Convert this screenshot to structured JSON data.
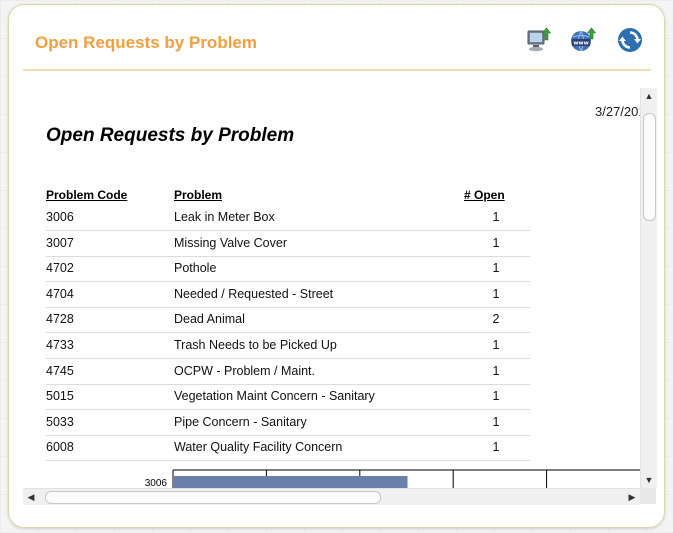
{
  "panel": {
    "title": "Open Requests by Problem",
    "title_color": "#f0a040",
    "toolbar_icons": [
      "export-computer-icon",
      "publish-web-icon",
      "refresh-icon"
    ]
  },
  "report": {
    "date": "3/27/201",
    "title": "Open Requests by Problem",
    "columns": [
      "Problem Code",
      "Problem",
      "# Open"
    ],
    "rows": [
      {
        "code": "3006",
        "problem": "Leak in Meter Box",
        "open": "1"
      },
      {
        "code": "3007",
        "problem": "Missing Valve Cover",
        "open": "1"
      },
      {
        "code": "4702",
        "problem": "Pothole",
        "open": "1"
      },
      {
        "code": "4704",
        "problem": "Needed / Requested - Street",
        "open": "1"
      },
      {
        "code": "4728",
        "problem": "Dead Animal",
        "open": "2"
      },
      {
        "code": "4733",
        "problem": "Trash Needs to be Picked Up",
        "open": "1"
      },
      {
        "code": "4745",
        "problem": "OCPW - Problem / Maint.",
        "open": "1"
      },
      {
        "code": "5015",
        "problem": "Vegetation Maint Concern - Sanitary",
        "open": "1"
      },
      {
        "code": "5033",
        "problem": "Pipe Concern - Sanitary",
        "open": "1"
      },
      {
        "code": "6008",
        "problem": "Water Quality Facility Concern",
        "open": "1"
      }
    ]
  },
  "chart_data": {
    "type": "bar",
    "orientation": "horizontal",
    "categories": [
      "3006"
    ],
    "values": [
      1
    ],
    "xlim": [
      0,
      2
    ],
    "bar_color": "#6a80a8"
  }
}
